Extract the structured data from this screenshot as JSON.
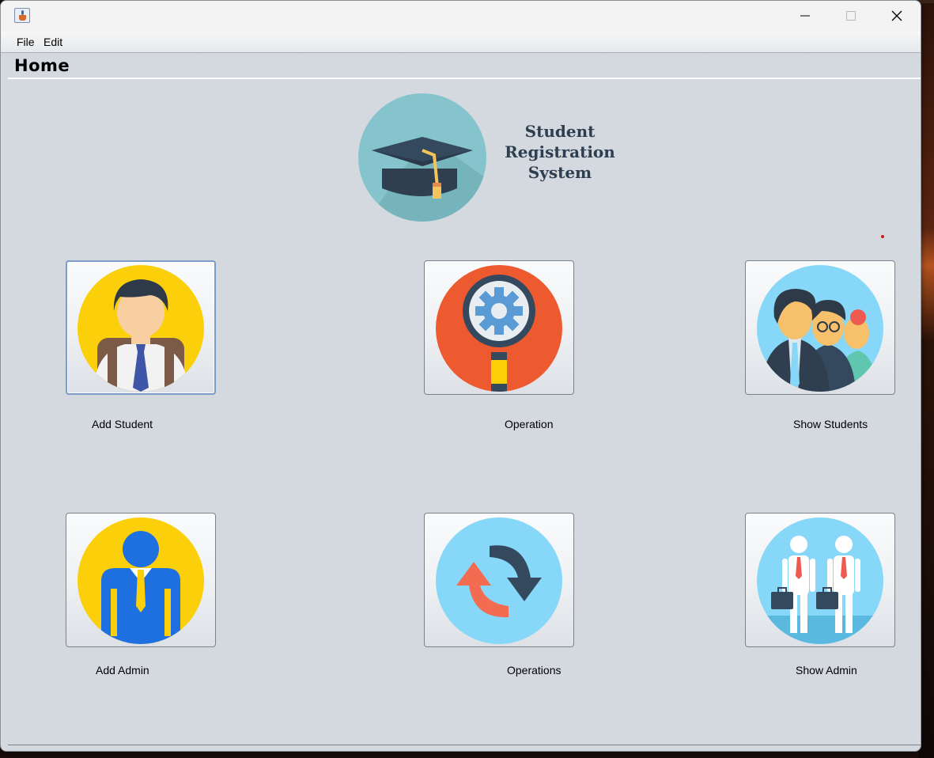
{
  "window": {
    "menu": [
      "File",
      "Edit"
    ],
    "controls": [
      "minimize-icon",
      "maximize-icon",
      "close-icon"
    ]
  },
  "page": {
    "title": "Home"
  },
  "logo": {
    "icon": "graduation-cap-icon",
    "text_lines": [
      "Student",
      "Registration",
      "System"
    ]
  },
  "tiles": [
    {
      "label": "Add Student",
      "icon": "student-icon"
    },
    {
      "label": "Operation",
      "icon": "magnifier-gear-icon"
    },
    {
      "label": "Show Students",
      "icon": "students-group-icon"
    },
    {
      "label": "Add Admin",
      "icon": "admin-icon"
    },
    {
      "label": "Operations",
      "icon": "refresh-arrows-icon"
    },
    {
      "label": "Show Admin",
      "icon": "admins-group-icon"
    }
  ],
  "colors": {
    "background": "#d4d8df",
    "logo_circle": "#85c4cc",
    "yellow": "#fbcf0a",
    "orange_red": "#ee5a2f",
    "light_blue": "#87d8f8",
    "navy": "#34495e"
  }
}
